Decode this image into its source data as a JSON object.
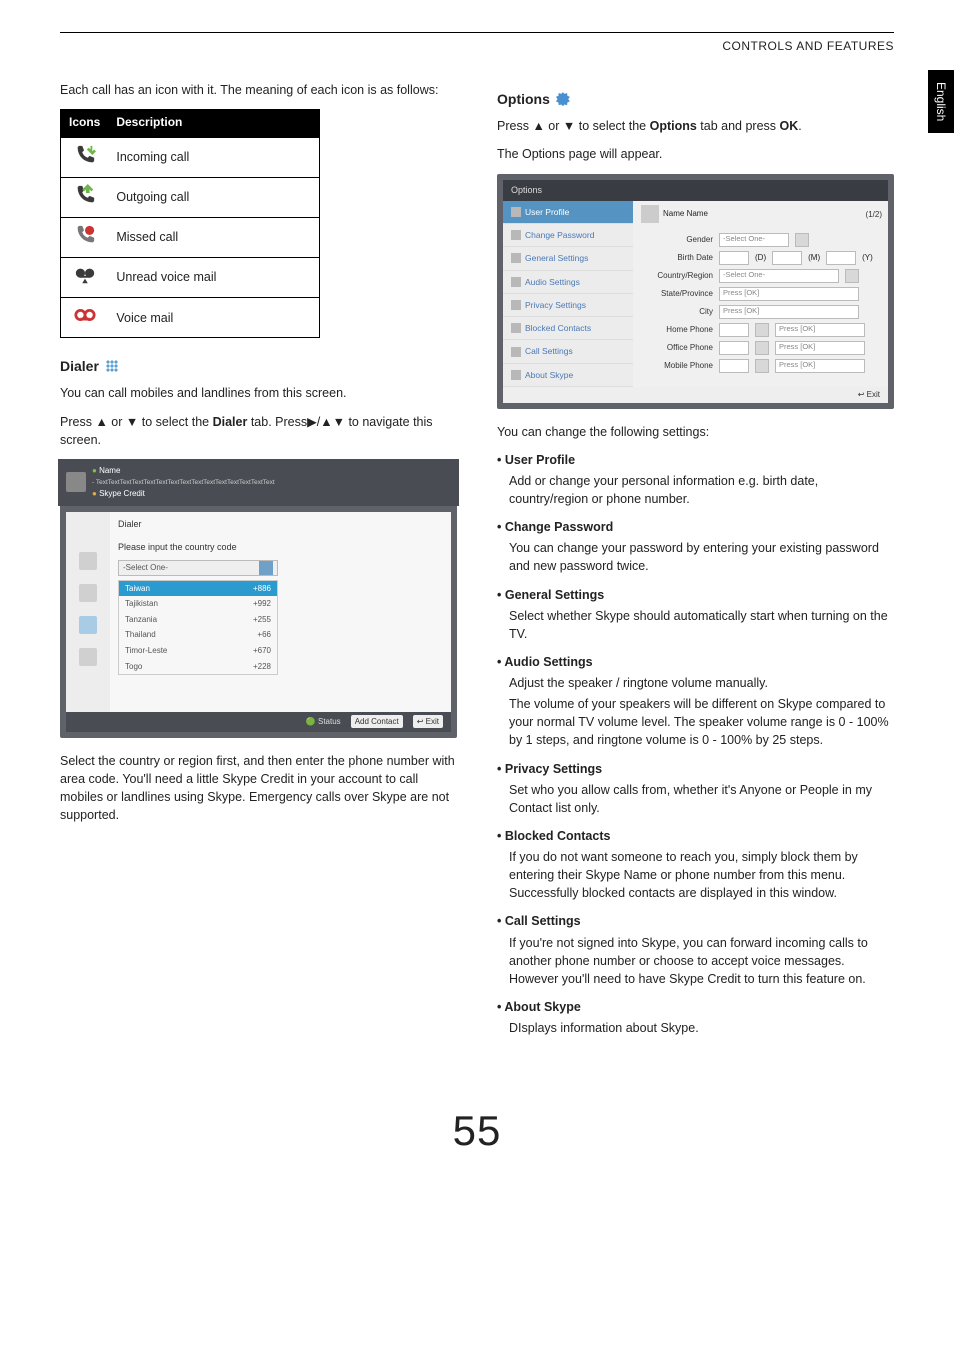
{
  "header": {
    "section": "CONTROLS AND FEATURES",
    "lang_tab": "English"
  },
  "left": {
    "intro": "Each call has an icon with it. The meaning of each icon is as follows:",
    "table": {
      "h1": "Icons",
      "h2": "Description",
      "rows": [
        "Incoming call",
        "Outgoing call",
        "Missed call",
        "Unread voice mail",
        "Voice mail"
      ]
    },
    "dialer_heading": "Dialer",
    "p1": "You can call mobiles and landlines from this screen.",
    "p2_a": "Press ",
    "p2_b": " or ",
    "p2_c": " to select  the ",
    "p2_bold": "Dialer",
    "p2_d": " tab. Press",
    "p2_e": "/",
    "p2_f": " to navigate this screen.",
    "dialer": {
      "name": "Name",
      "sub": "- TextTextTextTextTextTextTextTextTextTextTextTextTextTextText",
      "credit": "Skype Credit",
      "tab": "Dialer",
      "prompt": "Please input the country code",
      "select": "-Select One-",
      "countries": [
        {
          "n": "Taiwan",
          "c": "+886"
        },
        {
          "n": "Tajikistan",
          "c": "+992"
        },
        {
          "n": "Tanzania",
          "c": "+255"
        },
        {
          "n": "Thailand",
          "c": "+66"
        },
        {
          "n": "Timor-Leste",
          "c": "+670"
        },
        {
          "n": "Togo",
          "c": "+228"
        }
      ],
      "footer": {
        "status": "Status",
        "add": "Add Contact",
        "exit": "Exit"
      }
    },
    "p3": "Select the country or region first, and then enter the phone number with area code. You'll need a little Skype Credit in your account to call mobiles or landlines using Skype. Emergency calls over Skype are not supported."
  },
  "right": {
    "options_heading": "Options",
    "p1_a": "Press ",
    "p1_b": " or ",
    "p1_c": " to select  the ",
    "p1_bold": "Options",
    "p1_d": " tab and press ",
    "p1_bold2": "OK",
    "p1_e": ".",
    "p2": "The Options page will appear.",
    "shot": {
      "title": "Options",
      "nav": [
        "User Profile",
        "Change Password",
        "General Settings",
        "Audio Settings",
        "Privacy Settings",
        "Blocked Contacts",
        "Call Settings",
        "About Skype"
      ],
      "name": "Name Name",
      "page": "(1/2)",
      "fields": {
        "gender": "Gender",
        "birth": "Birth Date",
        "country": "Country/Region",
        "state": "State/Province",
        "city": "City",
        "home": "Home Phone",
        "office": "Office Phone",
        "mobile": "Mobile Phone",
        "sel": "-Select One-",
        "ok": "Press [OK]",
        "d": "(D)",
        "m": "(M)",
        "y": "(Y)"
      },
      "exit": "Exit"
    },
    "p3": "You can change the following settings:",
    "features": [
      {
        "h": "User Profile",
        "b": "Add or change your personal information e.g. birth date, country/region or phone number."
      },
      {
        "h": "Change Password",
        "b": "You can change your password by entering your existing password and new password twice."
      },
      {
        "h": "General Settings",
        "b": "Select whether Skype should automatically start when turning on the TV."
      },
      {
        "h": "Audio Settings",
        "b": "Adjust the speaker / ringtone volume manually.",
        "b2": "The volume of your speakers will be different on Skype compared to your normal TV volume level. The speaker volume range is 0 - 100% by 1 steps, and ringtone volume is 0 - 100% by 25 steps."
      },
      {
        "h": "Privacy Settings",
        "b": "Set who you allow calls from, whether it's Anyone or People in my Contact list only."
      },
      {
        "h": "Blocked Contacts",
        "b": "If you do not want someone to reach you, simply block them by entering their Skype Name or phone number from this menu. Successfully blocked contacts are displayed in this window."
      },
      {
        "h": "Call Settings",
        "b": "If you're not signed into Skype, you can forward incoming calls to another phone number or choose to accept voice messages. However you'll need to have Skype Credit to turn this feature on."
      },
      {
        "h": "About Skype",
        "b": "DIsplays information about Skype."
      }
    ]
  },
  "pagenum": "55",
  "glyphs": {
    "up": "▲",
    "down": "▼",
    "right": "▶"
  }
}
